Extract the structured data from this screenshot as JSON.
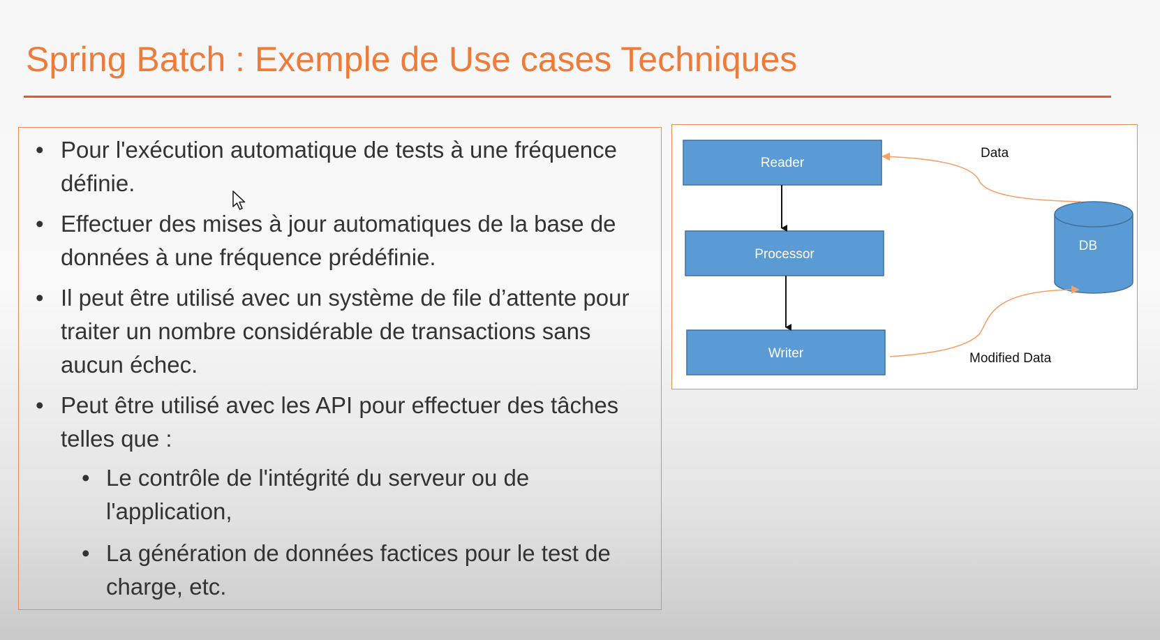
{
  "slide": {
    "title": "Spring Batch : Exemple de Use cases Techniques",
    "bullets": [
      "Pour l'exécution automatique de tests à une fréquence définie.",
      "Effectuer des mises à jour automatiques de la base de données à une fréquence prédéfinie.",
      "Il peut être utilisé avec un système de file d’attente pour traiter un nombre considérable de transactions sans aucun échec.",
      "Peut être utilisé avec les API pour effectuer des tâches telles que :"
    ],
    "sub_bullets": [
      "Le contrôle de l'intégrité du serveur ou de l'application,",
      "La génération de données factices pour le test de charge,  etc."
    ],
    "bullet_glyph": "•"
  },
  "diagram": {
    "nodes": {
      "reader": "Reader",
      "processor": "Processor",
      "writer": "Writer",
      "db": "DB"
    },
    "edges": {
      "data": "Data",
      "modified_data": "Modified Data"
    },
    "colors": {
      "node_fill": "#5b9bd5",
      "node_stroke": "#41719c",
      "arrow_orange": "#f4a06a",
      "title": "#ee7b38",
      "rule": "#e8542a"
    }
  }
}
